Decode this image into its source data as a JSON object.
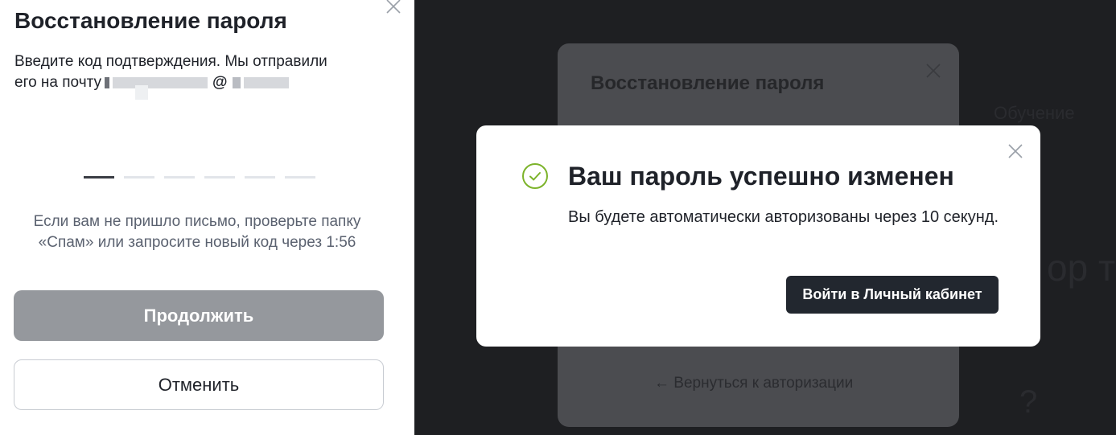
{
  "left_panel": {
    "title": "Восстановление пароля",
    "desc_line1": "Введите код подтверждения. Мы отправили",
    "desc_line2_prefix": "его на почту",
    "email_at": "@",
    "code_length": 6,
    "resend_line1": "Если вам не пришло письмо, проверьте папку",
    "resend_line2": "«Спам» или запросите новый код через 1:56",
    "continue_label": "Продолжить",
    "cancel_label": "Отменить"
  },
  "background_card": {
    "title": "Восстановление пароля",
    "back_link": "← Вернуться к авторизации",
    "side_text_1": "Обучение",
    "side_text_2": "ор те",
    "side_text_3": "?"
  },
  "modal": {
    "title": "Ваш пароль успешно изменен",
    "text": "Вы будете автоматически авторизованы через 10 секунд.",
    "button_label": "Войти в Личный кабинет",
    "icon": "check-circle-icon",
    "close_icon": "close-icon"
  },
  "colors": {
    "success_green": "#7cb32a",
    "button_dark": "#22272f",
    "button_disabled": "#95989d",
    "overlay": "#1e1f22"
  }
}
